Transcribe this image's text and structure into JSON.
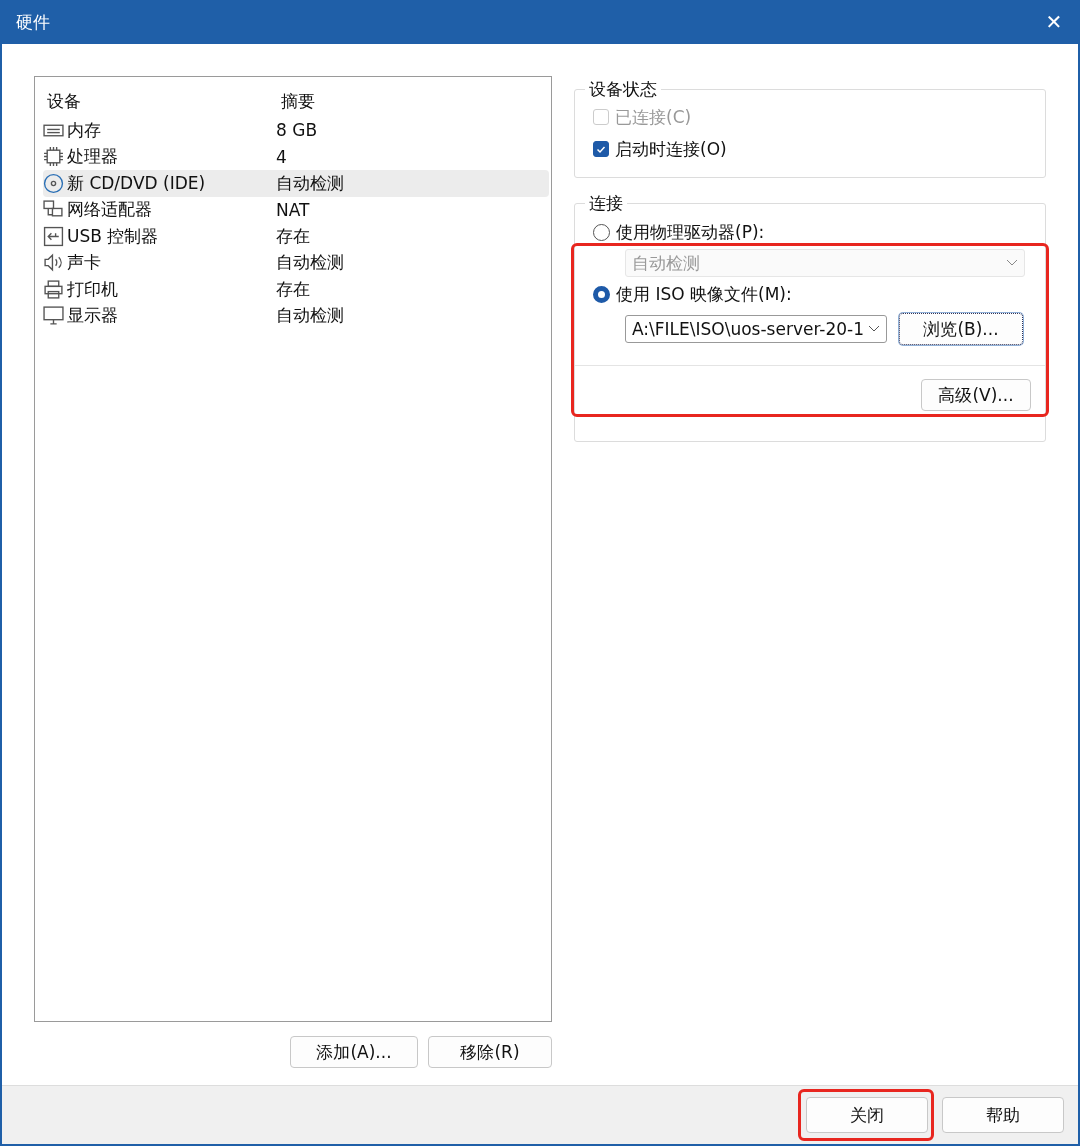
{
  "window": {
    "title": "硬件",
    "close": "✕"
  },
  "device_list": {
    "columns": [
      "设备",
      "摘要"
    ],
    "rows": [
      {
        "kind": "memory",
        "device": "内存",
        "summary": "8 GB",
        "selected": false
      },
      {
        "kind": "cpu",
        "device": "处理器",
        "summary": "4",
        "selected": false
      },
      {
        "kind": "cd",
        "device": "新 CD/DVD (IDE)",
        "summary": "自动检测",
        "selected": true
      },
      {
        "kind": "network",
        "device": "网络适配器",
        "summary": "NAT",
        "selected": false
      },
      {
        "kind": "usb",
        "device": "USB 控制器",
        "summary": "存在",
        "selected": false
      },
      {
        "kind": "sound",
        "device": "声卡",
        "summary": "自动检测",
        "selected": false
      },
      {
        "kind": "printer",
        "device": "打印机",
        "summary": "存在",
        "selected": false
      },
      {
        "kind": "display",
        "device": "显示器",
        "summary": "自动检测",
        "selected": false
      }
    ],
    "buttons": [
      "添加(A)...",
      "移除(R)"
    ]
  },
  "device_status": {
    "title": "设备状态",
    "options": [
      {
        "label": "已连接(C)",
        "checked": false,
        "disabled": true
      },
      {
        "label": "启动时连接(O)",
        "checked": true,
        "disabled": false
      }
    ]
  },
  "connection": {
    "title": "连接",
    "highlighted": true,
    "physical": {
      "label": "使用物理驱动器(P):",
      "selected": false,
      "drive": "自动检测",
      "drive_disabled": true
    },
    "iso": {
      "label": "使用 ISO 映像文件(M):",
      "selected": true,
      "path": "A:\\FILE\\ISO\\uos-server-20-1",
      "browse": "浏览(B)..."
    },
    "advanced": "高级(V)..."
  },
  "footer": {
    "buttons": [
      {
        "label": "关闭",
        "highlighted": true
      },
      {
        "label": "帮助",
        "highlighted": false
      }
    ]
  }
}
